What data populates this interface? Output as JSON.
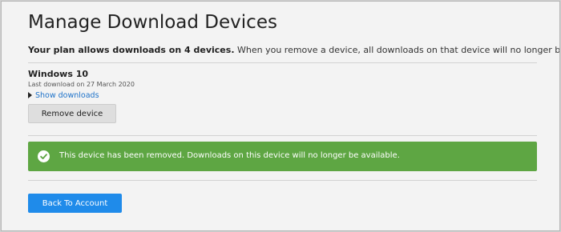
{
  "page": {
    "title": "Manage Download Devices"
  },
  "plan": {
    "bold_text": "Your plan allows downloads on 4 devices.",
    "text": " When you remove a device, all downloads on that device will no longer be available."
  },
  "device": {
    "name": "Windows 10",
    "last_download": "Last download on 27 March 2020",
    "show_downloads_label": "Show downloads",
    "remove_label": "Remove device"
  },
  "alert": {
    "message": "This device has been removed. Downloads on this device will no longer be available.",
    "color": "#5ea643",
    "icon": "check-circle-icon"
  },
  "actions": {
    "back_label": "Back To Account",
    "back_color": "#1f8bea"
  },
  "colors": {
    "link": "#1d72c9",
    "background": "#f3f3f3"
  }
}
